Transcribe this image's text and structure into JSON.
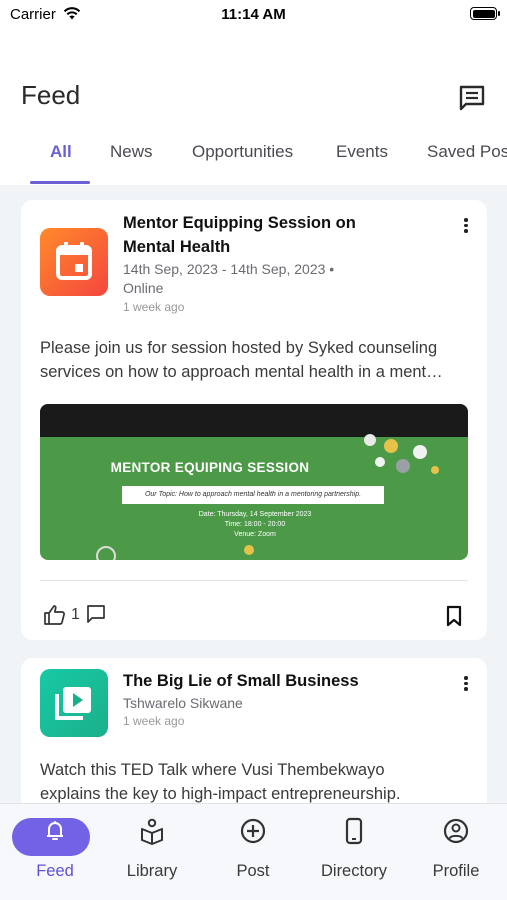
{
  "status_bar": {
    "carrier": "Carrier",
    "time": "11:14 AM"
  },
  "header": {
    "title": "Feed",
    "chat_icon": "chat-bubble-icon"
  },
  "tabs": [
    {
      "label": "All",
      "active": true
    },
    {
      "label": "News"
    },
    {
      "label": "Opportunities"
    },
    {
      "label": "Events"
    },
    {
      "label": "Saved Pos"
    }
  ],
  "posts": [
    {
      "icon": "calendar-icon",
      "title_line1": "Mentor Equipping Session on",
      "title_line2": "Mental Health",
      "dates": "14th Sep, 2023 - 14th Sep, 2023 •",
      "location": "Online",
      "posted": "1 week ago",
      "body_line1": "Please join us for session hosted by Syked counseling",
      "body_line2": "services on how to approach mental health in a ment…",
      "banner": {
        "heading": "MENTOR EQUIPING SESSION",
        "topic": "Our Topic: How to approach mental health in a mentoring partnership.",
        "date": "Date: Thursday, 14 September 2023",
        "time": "Time: 18:00 - 20:00",
        "venue": "Venue: Zoom"
      },
      "likes": "1"
    },
    {
      "icon": "video-library-icon",
      "title_line1": "The Big Lie of Small Business",
      "author": "Tshwarelo Sikwane",
      "posted": "1 week ago",
      "body_line1": "Watch this TED Talk where Vusi Thembekwayo",
      "body_line2": "explains the key to high-impact entrepreneurship."
    }
  ],
  "bottom_nav": [
    {
      "label": "Feed",
      "icon": "bell-icon",
      "active": true
    },
    {
      "label": "Library",
      "icon": "library-icon"
    },
    {
      "label": "Post",
      "icon": "plus-circle-icon"
    },
    {
      "label": "Directory",
      "icon": "phone-icon"
    },
    {
      "label": "Profile",
      "icon": "user-circle-icon"
    }
  ],
  "colors": {
    "accent": "#6a5fd6",
    "nav_pill": "#7263e6",
    "banner_green": "#4c9a48",
    "event_orange": "#f5463f",
    "video_teal": "#17c9a6"
  }
}
